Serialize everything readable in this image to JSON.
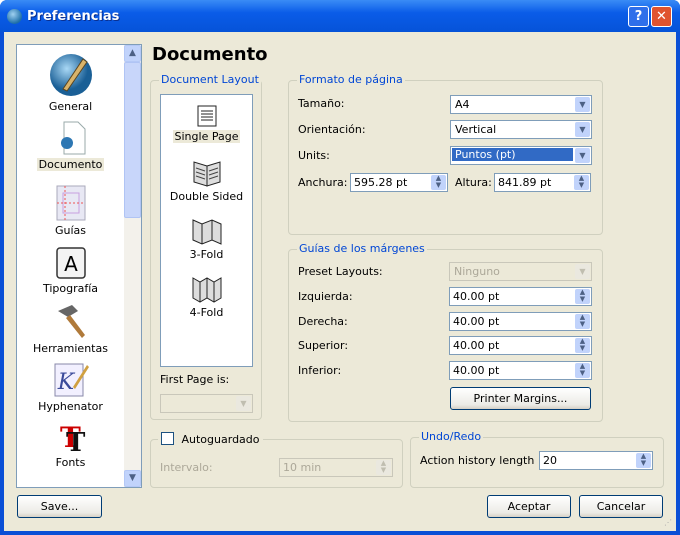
{
  "window": {
    "title": "Preferencias",
    "help_label": "?",
    "close_label": "✕"
  },
  "sidebar": {
    "items": [
      {
        "label": "General",
        "icon": "general-pen-globe-icon"
      },
      {
        "label": "Documento",
        "icon": "document-icon",
        "selected": true
      },
      {
        "label": "Guías",
        "icon": "guides-icon"
      },
      {
        "label": "Tipografía",
        "icon": "typography-icon"
      },
      {
        "label": "Herramientas",
        "icon": "hammer-icon"
      },
      {
        "label": "Hyphenator",
        "icon": "hyphenator-icon"
      },
      {
        "label": "Fonts",
        "icon": "fonts-icon"
      }
    ]
  },
  "page_title": "Documento",
  "layout": {
    "legend": "Document Layout",
    "items": [
      {
        "label": "Single Page",
        "selected": true
      },
      {
        "label": "Double Sided"
      },
      {
        "label": "3-Fold"
      },
      {
        "label": "4-Fold"
      }
    ],
    "first_page_label": "First Page is:",
    "first_page_value": ""
  },
  "format": {
    "legend": "Formato de página",
    "size_label": "Tamaño:",
    "size_value": "A4",
    "orientation_label": "Orientación:",
    "orientation_value": "Vertical",
    "units_label": "Units:",
    "units_value": "Puntos (pt)",
    "width_label": "Anchura:",
    "width_value": "595.28 pt",
    "height_label": "Altura:",
    "height_value": "841.89 pt"
  },
  "margins": {
    "legend": "Guías de los márgenes",
    "preset_label": "Preset Layouts:",
    "preset_value": "Ninguno",
    "left_label": "Izquierda:",
    "left_value": "40.00 pt",
    "right_label": "Derecha:",
    "right_value": "40.00 pt",
    "top_label": "Superior:",
    "top_value": "40.00 pt",
    "bottom_label": "Inferior:",
    "bottom_value": "40.00 pt",
    "printer_button": "Printer Margins..."
  },
  "autosave": {
    "label": "Autoguardado",
    "checked": false,
    "interval_label": "Intervalo:",
    "interval_value": "10 min"
  },
  "undo": {
    "legend": "Undo/Redo",
    "history_label": "Action history length",
    "history_value": "20"
  },
  "buttons": {
    "save": "Save...",
    "ok": "Aceptar",
    "cancel": "Cancelar"
  },
  "colors": {
    "titlebar": "#0A5CE8",
    "legend": "#0046D5",
    "selection": "#316AC5",
    "dialog_bg": "#ECE9D8"
  }
}
